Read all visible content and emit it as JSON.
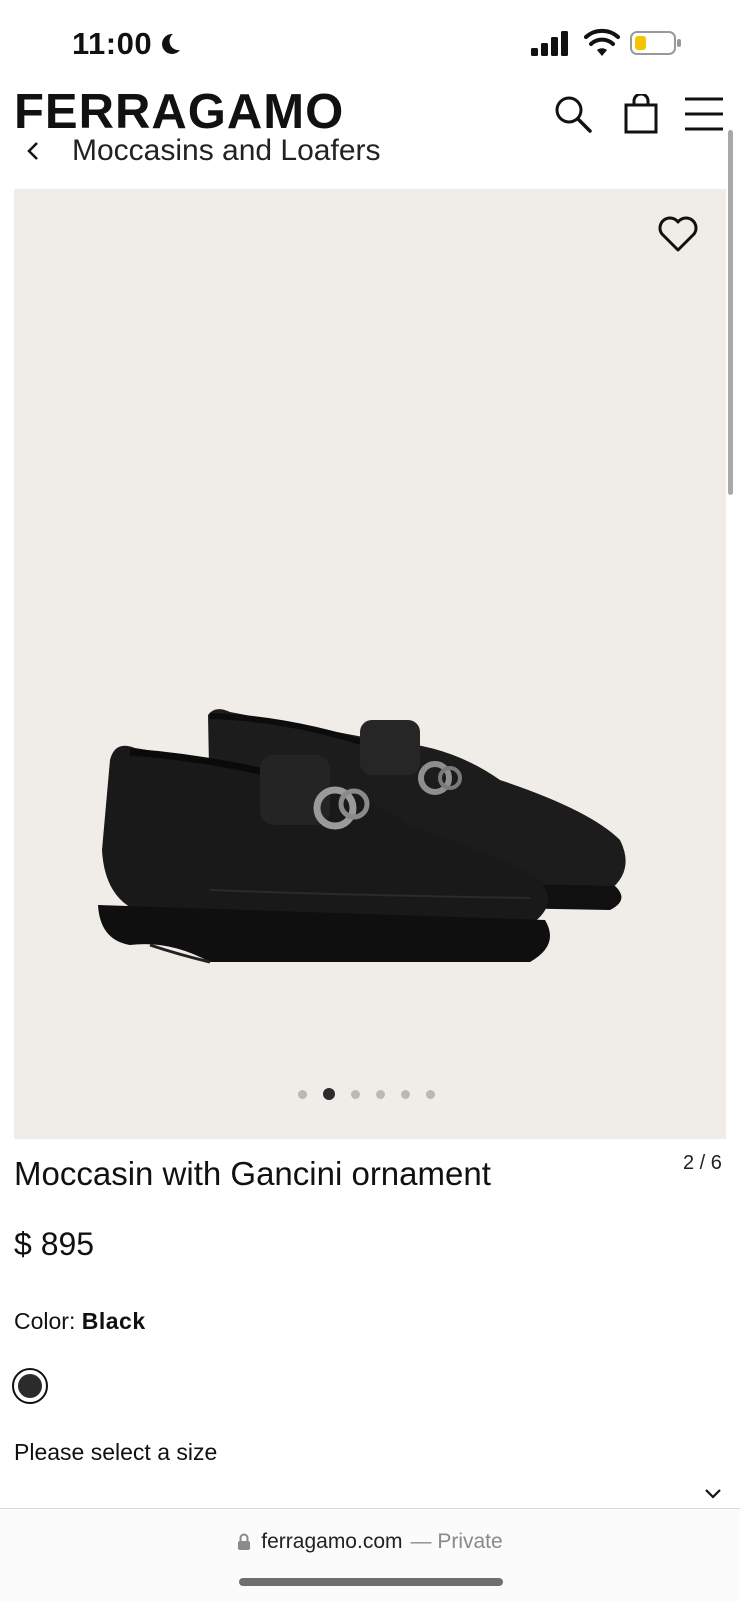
{
  "status_bar": {
    "time": "11:00",
    "icons": [
      "moon-icon",
      "cellular-signal-icon",
      "wifi-icon",
      "battery-icon"
    ],
    "battery_color": "#f5c400"
  },
  "header": {
    "brand": "FERRAGAMO",
    "icons": [
      "search-icon",
      "shopping-bag-icon",
      "hamburger-menu-icon"
    ]
  },
  "breadcrumb": {
    "label": "Moccasins and Loafers"
  },
  "gallery": {
    "background": "#f0ece7",
    "dots_total": 6,
    "active_index": 2,
    "counter": "2 / 6"
  },
  "product": {
    "title": "Moccasin with Gancini ornament",
    "price": "$ 895",
    "color_label": "Color:",
    "color_value": "Black",
    "swatch_color": "#2b2b2b",
    "size_prompt": "Please select a size"
  },
  "browser": {
    "domain": "ferragamo.com",
    "privacy": "— Private"
  }
}
